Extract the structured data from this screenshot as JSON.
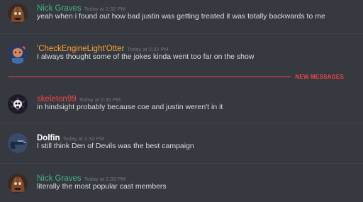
{
  "colors": {
    "background": "#36393f",
    "message_text": "#dcddde",
    "timestamp": "#72767d",
    "new_messages_accent": "#f04747",
    "nick_graves": "#43b581",
    "checkenginelight_otter": "#f8a532",
    "skeleton99": "#f04747",
    "dolfin": "#ffffff"
  },
  "new_messages": {
    "label": "NEW MESSAGES"
  },
  "messages": [
    {
      "author": "Nick Graves",
      "timestamp": "Today at 2:32 PM",
      "text": "yeah when i found out how bad justin was getting treated it was totally backwards to me",
      "avatar": "monster-avatar"
    },
    {
      "author": "'CheckEngineLight'Otter",
      "timestamp": "Today at 2:32 PM",
      "text": "I always thought some of the jokes kinda went too far on the show",
      "avatar": "character-avatar"
    },
    {
      "author": "skeleton99",
      "timestamp": "Today at 2:32 PM",
      "text": "in hindsight probably because coe and justin weren't in it",
      "avatar": "skull-avatar"
    },
    {
      "author": "Dolfin",
      "timestamp": "Today at 2:32 PM",
      "text": "I still think Den of Devils was the best campaign",
      "avatar": "gun-avatar"
    },
    {
      "author": "Nick Graves",
      "timestamp": "Today at 2:33 PM",
      "text": "literally the most popular cast members",
      "avatar": "monster-avatar"
    }
  ]
}
